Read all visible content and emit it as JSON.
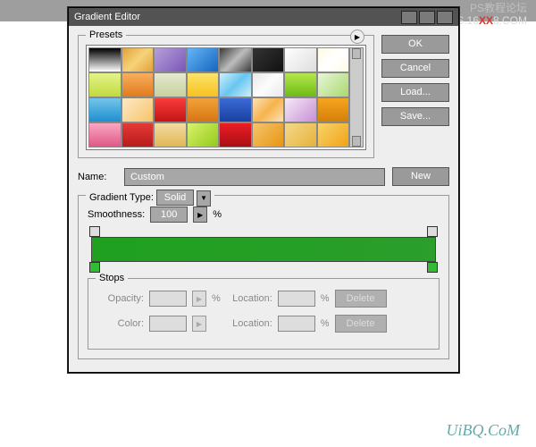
{
  "watermark": {
    "cn": "PS教程论坛",
    "site1": "BBS.16",
    "site_x": "XX",
    "site2": "8.COM",
    "bottom": "UiBQ.CoM"
  },
  "dialog": {
    "title": "Gradient Editor",
    "buttons": {
      "ok": "OK",
      "cancel": "Cancel",
      "load": "Load...",
      "save": "Save...",
      "new": "New",
      "delete": "Delete"
    },
    "presets_label": "Presets",
    "name_label": "Name:",
    "name_value": "Custom",
    "gtype_label": "Gradient Type:",
    "gtype_value": "Solid",
    "smooth_label": "Smoothness:",
    "smooth_value": "100",
    "pct": "%",
    "stops_label": "Stops",
    "opacity_label": "Opacity:",
    "color_label": "Color:",
    "location_label": "Location:",
    "swatches": [
      "linear-gradient(#000,#fff)",
      "linear-gradient(135deg,#e3a13a,#f5d37a,#e3a13a)",
      "linear-gradient(135deg,#b6a0d8,#7a55b8)",
      "linear-gradient(135deg,#64b5f6,#1565c0)",
      "linear-gradient(135deg,#3a3a3a,#bdbdbd,#3a3a3a)",
      "linear-gradient(135deg,#333,#111)",
      "linear-gradient(135deg,#fff,#ddd)",
      "linear-gradient(135deg,#fffbe6,#fff,#fffbe6)",
      "linear-gradient(#e6f28a,#c0db3c)",
      "linear-gradient(#f8ae5c,#e07b1d)",
      "linear-gradient(#e4e9cf,#c7d19d)",
      "linear-gradient(#fbe36a,#f7c21e)",
      "linear-gradient(135deg,#d0f0fb,#68c5ef,#d0f0fb)",
      "linear-gradient(135deg,#e8e8e8,#fcfcfc,#e8e8e8)",
      "linear-gradient(#b4e84a,#6dbb16)",
      "linear-gradient(135deg,#e8f6d8,#a9d870)",
      "linear-gradient(#73c5ea,#1f8fcf)",
      "linear-gradient(135deg,#fde9c5,#f6c46a)",
      "linear-gradient(#fa3b3b,#c41515)",
      "linear-gradient(#f2a23a,#d77613)",
      "linear-gradient(#3a6bd6,#1a3fa0)",
      "linear-gradient(135deg,#fce2b6,#f7b34d,#fce2b6)",
      "linear-gradient(135deg,#f6eaf7,#c88fd6)",
      "linear-gradient(#f6a51e,#d57f0a)",
      "linear-gradient(#f9a7c2,#e05787)",
      "linear-gradient(#e53935,#b71c1c)",
      "linear-gradient(#f3dca1,#e1b654)",
      "linear-gradient(135deg,#d8f36a,#93c91a)",
      "linear-gradient(#ed1c24,#a80f15)",
      "linear-gradient(135deg,#f4c56a,#e89514)",
      "linear-gradient(135deg,#f4d98a,#e6b23a)",
      "linear-gradient(135deg,#f9d36a,#f0a318)"
    ]
  }
}
